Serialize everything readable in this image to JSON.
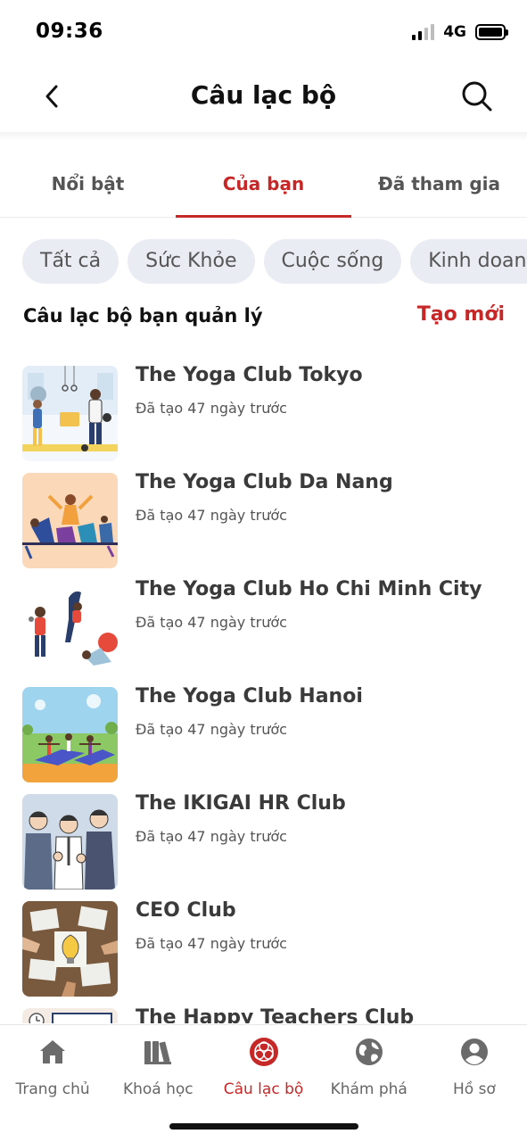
{
  "status": {
    "time": "09:36",
    "network": "4G"
  },
  "header": {
    "title": "Câu lạc bộ"
  },
  "tabs": [
    {
      "label": "Nổi bật",
      "active": false
    },
    {
      "label": "Của bạn",
      "active": true
    },
    {
      "label": "Đã tham gia",
      "active": false
    }
  ],
  "chips": [
    "Tất cả",
    "Sức Khỏe",
    "Cuộc sống",
    "Kinh doanh"
  ],
  "section": {
    "title": "Câu lạc bộ bạn quản lý",
    "action": "Tạo mới"
  },
  "clubs": [
    {
      "name": "The Yoga Club Tokyo",
      "meta": "Đã tạo 47 ngày trước",
      "thumb": "gym-illustration"
    },
    {
      "name": "The Yoga Club Da Nang",
      "meta": "Đã tạo 47 ngày trước",
      "thumb": "fitness-class-illustration"
    },
    {
      "name": "The Yoga Club Ho Chi Minh City",
      "meta": "Đã tạo 47 ngày trước",
      "thumb": "yoga-poses-illustration"
    },
    {
      "name": "The Yoga Club Hanoi",
      "meta": "Đã tạo 47 ngày trước",
      "thumb": "outdoor-yoga-illustration"
    },
    {
      "name": "The IKIGAI HR Club",
      "meta": "Đã tạo 47 ngày trước",
      "thumb": "business-team-illustration"
    },
    {
      "name": "CEO Club",
      "meta": "Đã tạo 47 ngày trước",
      "thumb": "idea-meeting-photo"
    },
    {
      "name": "The Happy Teachers Club",
      "meta": "",
      "thumb": "classroom-illustration"
    }
  ],
  "nav": [
    {
      "label": "Trang chủ",
      "icon": "home-icon",
      "active": false
    },
    {
      "label": "Khoá học",
      "icon": "books-icon",
      "active": false
    },
    {
      "label": "Câu lạc bộ",
      "icon": "club-icon",
      "active": true
    },
    {
      "label": "Khám phá",
      "icon": "globe-icon",
      "active": false
    },
    {
      "label": "Hồ sơ",
      "icon": "profile-icon",
      "active": false
    }
  ],
  "colors": {
    "accent": "#c62828",
    "chip_bg": "#e9ecf2",
    "nav_icon": "#6b6b6b"
  }
}
